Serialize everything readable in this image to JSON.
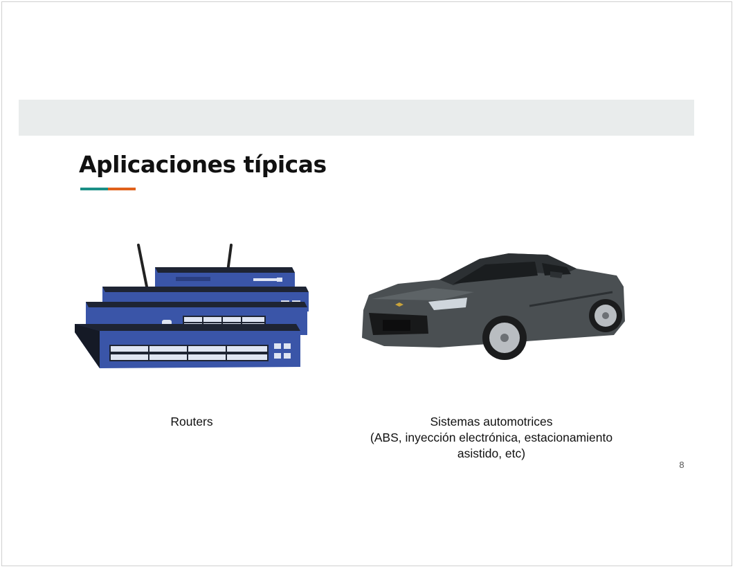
{
  "slide": {
    "title": "Aplicaciones típicas",
    "page_number": "8",
    "accent_colors": [
      "#1a8f86",
      "#e0611a"
    ],
    "band_color": "#e9ecec"
  },
  "items": [
    {
      "image": "network-router-stack",
      "caption": "Routers"
    },
    {
      "image": "sports-car",
      "caption_lines": [
        "Sistemas automotrices",
        "(ABS, inyección electrónica, estacionamiento",
        "asistido, etc)"
      ]
    }
  ]
}
